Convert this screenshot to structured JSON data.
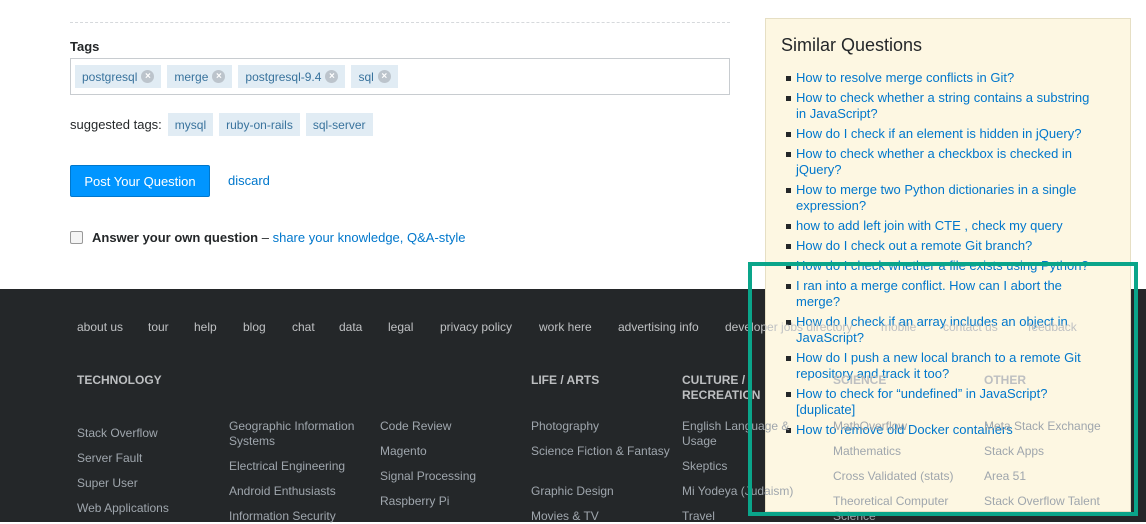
{
  "form": {
    "tags_label": "Tags",
    "tags": [
      "postgresql",
      "merge",
      "postgresql-9.4",
      "sql"
    ],
    "remove_icon": "×",
    "suggested_label": "suggested tags:",
    "suggested": [
      "mysql",
      "ruby-on-rails",
      "sql-server"
    ],
    "post_button": "Post Your Question",
    "discard": "discard",
    "answer_own": "Answer your own question",
    "answer_dash": " – ",
    "answer_link": "share your knowledge, Q&A-style"
  },
  "sidebar": {
    "title": "Similar Questions",
    "items": [
      "How to resolve merge conflicts in Git?",
      "How to check whether a string contains a substring in JavaScript?",
      "How do I check if an element is hidden in jQuery?",
      "How to check whether a checkbox is checked in jQuery?",
      "How to merge two Python dictionaries in a single expression?",
      "how to add left join with CTE , check my query",
      "How do I check out a remote Git branch?",
      "How do I check whether a file exists using Python?",
      "I ran into a merge conflict. How can I abort the merge?",
      "How do I check if an array includes an object in JavaScript?",
      "How do I push a new local branch to a remote Git repository and track it too?",
      "How to check for “undefined” in JavaScript? [duplicate]",
      "How to remove old Docker containers"
    ]
  },
  "footer": {
    "links": [
      "about us",
      "tour",
      "help",
      "blog",
      "chat",
      "data",
      "legal",
      "privacy policy",
      "work here",
      "advertising info",
      "developer jobs directory",
      "mobile",
      "contact us",
      "feedback"
    ],
    "columns": [
      {
        "heading": "TECHNOLOGY",
        "items": [
          "Stack Overflow",
          "Server Fault",
          "Super User",
          "Web Applications"
        ]
      },
      {
        "heading": "",
        "items": [
          "Geographic Information Systems",
          "Electrical Engineering",
          "Android Enthusiasts",
          "Information Security"
        ]
      },
      {
        "heading": "",
        "items": [
          "Code Review",
          "Magento",
          "Signal Processing",
          "Raspberry Pi"
        ]
      },
      {
        "heading": "LIFE / ARTS",
        "items": [
          "Photography",
          "Science Fiction & Fantasy",
          "Graphic Design",
          "Movies & TV"
        ]
      },
      {
        "heading": "CULTURE / RECREATION",
        "items": [
          "English Language & Usage",
          "Skeptics",
          "Mi Yodeya (Judaism)",
          "Travel"
        ]
      },
      {
        "heading": "SCIENCE",
        "items": [
          "MathOverflow",
          "Mathematics",
          "Cross Validated (stats)",
          "Theoretical Computer Science"
        ]
      },
      {
        "heading": "OTHER",
        "items": [
          "Meta Stack Exchange",
          "Stack Apps",
          "Area 51",
          "Stack Overflow Talent"
        ]
      }
    ]
  },
  "colors": {
    "accent": "#0095ff",
    "link": "#0077cc",
    "highlight": "#0aa58a",
    "sidebar_bg": "#fdf7e2",
    "footer_bg": "#242729"
  }
}
